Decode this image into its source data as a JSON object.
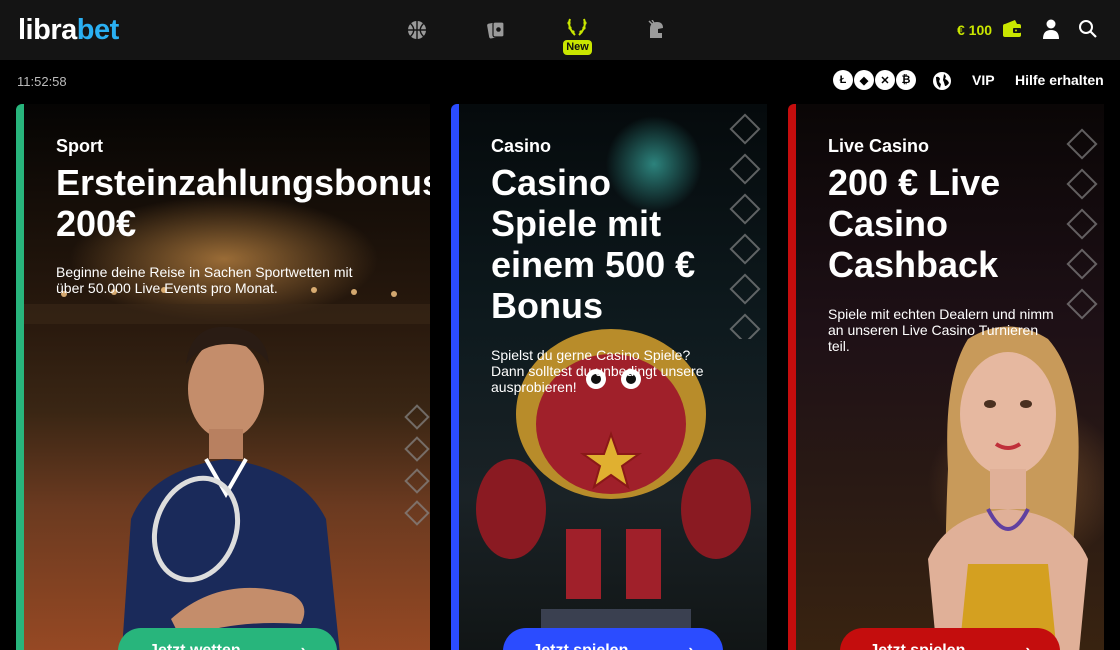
{
  "header": {
    "logo_part1": "libra",
    "logo_part2": "bet",
    "nav": [
      {
        "name": "sports",
        "icon": "basketball-icon"
      },
      {
        "name": "casino",
        "icon": "cards-icon"
      },
      {
        "name": "new",
        "icon": "laurel-icon",
        "badge": "New"
      },
      {
        "name": "live-casino",
        "icon": "helmet-icon"
      }
    ],
    "balance": "€ 100",
    "wallet_icon": "wallet-icon",
    "user_icon": "user-icon",
    "search_icon": "search-icon",
    "accent_color": "#c9e600"
  },
  "subbar": {
    "clock": "11:52:58",
    "crypto_icons": [
      "litecoin-icon",
      "ethereum-icon",
      "ripple-icon",
      "bitcoin-icon"
    ],
    "globe_icon": "globe-icon",
    "vip_label": "VIP",
    "help_label": "Hilfe erhalten"
  },
  "cards": [
    {
      "category": "Sport",
      "title_lines": [
        "Ersteinzahlungsbonus",
        "200€"
      ],
      "desc_lines": [
        "Beginne deine Reise in Sachen Sportwetten mit",
        "über 50.000 Live Events pro Monat."
      ],
      "cta": "Jetzt wetten",
      "color": "#28b57c"
    },
    {
      "category": "Casino",
      "title_lines": [
        "Casino",
        "Spiele mit",
        "einem 500 €",
        "Bonus"
      ],
      "desc_lines": [
        "Spielst du gerne Casino Spiele?",
        "Dann solltest du unbedingt unsere",
        "ausprobieren!"
      ],
      "cta": "Jetzt spielen",
      "color": "#2b4cff"
    },
    {
      "category": "Live Casino",
      "title_lines": [
        "200 € Live",
        "Casino",
        "Cashback"
      ],
      "desc_lines": [
        "Spiele mit echten Dealern und nimm",
        "an unseren Live Casino Turnieren",
        "teil."
      ],
      "cta": "Jetzt spielen",
      "color": "#c40d0d"
    }
  ]
}
